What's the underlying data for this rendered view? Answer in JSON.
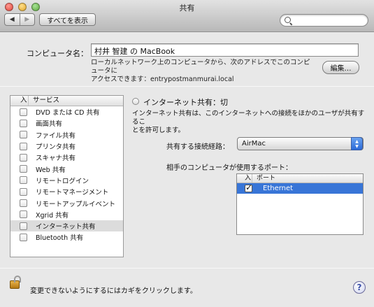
{
  "window": {
    "title": "共有"
  },
  "toolbar": {
    "back_glyph": "◀",
    "forward_glyph": "▶",
    "show_all_label": "すべてを表示",
    "search_placeholder": ""
  },
  "computer": {
    "name_label": "コンピュータ名：",
    "name_value": "村井 智建 の MacBook",
    "address_note_line1": "ローカルネットワーク上のコンピュータから、次のアドレスでこのコンピュータに",
    "address_note_line2": "アクセスできます：entrypostmanmurai.local",
    "edit_button": "編集…"
  },
  "services": {
    "header_check": "入",
    "header_name": "サービス",
    "items": [
      {
        "label": "DVD または CD 共有",
        "checked": false
      },
      {
        "label": "画面共有",
        "checked": false
      },
      {
        "label": "ファイル共有",
        "checked": false
      },
      {
        "label": "プリンタ共有",
        "checked": false
      },
      {
        "label": "スキャナ共有",
        "checked": false
      },
      {
        "label": "Web 共有",
        "checked": false
      },
      {
        "label": "リモートログイン",
        "checked": false
      },
      {
        "label": "リモートマネージメント",
        "checked": false
      },
      {
        "label": "リモートアップルイベント",
        "checked": false
      },
      {
        "label": "Xgrid 共有",
        "checked": false
      },
      {
        "label": "インターネット共有",
        "checked": false,
        "selected": true
      },
      {
        "label": "Bluetooth 共有",
        "checked": false
      }
    ]
  },
  "detail": {
    "status": "インターネット共有：切",
    "description_line1": "インターネット共有は、このインターネットへの接続をほかのユーザが共有するこ",
    "description_line2": "とを許可します。",
    "share_from_label": "共有する接続経路：",
    "share_from_value": "AirMac",
    "ports_label": "相手のコンピュータが使用するポート：",
    "ports_header_check": "入",
    "ports_header_name": "ポート",
    "ports": [
      {
        "label": "Ethernet",
        "checked": true,
        "selected": true
      }
    ]
  },
  "footer": {
    "lock_text": "変更できないようにするにはカギをクリックします。",
    "help_glyph": "?"
  },
  "colors": {
    "selection": "#3875d7",
    "list_selection": "#dcdcdc"
  }
}
